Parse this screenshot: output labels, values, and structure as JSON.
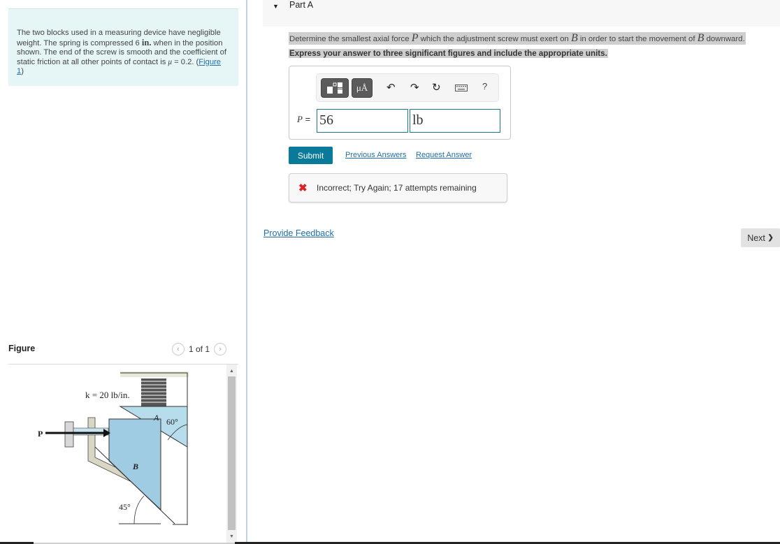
{
  "problem": {
    "text_part1": "The two blocks used in a measuring device have negligible weight. The spring is compressed 6 ",
    "unit_in": "in.",
    "text_part2": " when in the position shown. The end of the screw is smooth and the coefficient of static friction at all other points of contact is ",
    "mu_symbol": "μ",
    "mu_value": " = 0.2. (",
    "figure_link": "Figure 1",
    "close_paren": ")"
  },
  "figure": {
    "title": "Figure",
    "pager": "1 of 1",
    "prev_icon": "‹",
    "next_icon": "›",
    "labels": {
      "spring": "k = 20 lb/in.",
      "force": "P",
      "block_a": "A",
      "block_b": "B",
      "angle_a": "60°",
      "angle_b": "45°"
    }
  },
  "part": {
    "label": "Part A",
    "collapse_icon": "▼",
    "question_pre": "Determine the smallest axial force ",
    "question_var1": "P",
    "question_mid1": " which the adjustment screw must exert on ",
    "question_var2": "B",
    "question_mid2": " in order to start the movement of ",
    "question_var3": "B",
    "question_post": " downward.",
    "instruction": "Express your answer to three significant figures and include the appropriate units."
  },
  "answer": {
    "variable_label": "P",
    "equals": " =",
    "value": "56",
    "units": "lb",
    "toolbar": {
      "units_button": "μÅ",
      "undo_icon": "↶",
      "redo_icon": "↷",
      "reset_icon": "↻",
      "help": "?"
    }
  },
  "actions": {
    "submit": "Submit",
    "previous_answers": "Previous Answers",
    "request_answer": "Request Answer"
  },
  "feedback": {
    "icon": "✖",
    "message": "Incorrect; Try Again; 17 attempts remaining",
    "status_color": "#dd2222"
  },
  "footer": {
    "provide_feedback": "Provide Feedback",
    "next": "Next",
    "next_icon": "❯"
  }
}
